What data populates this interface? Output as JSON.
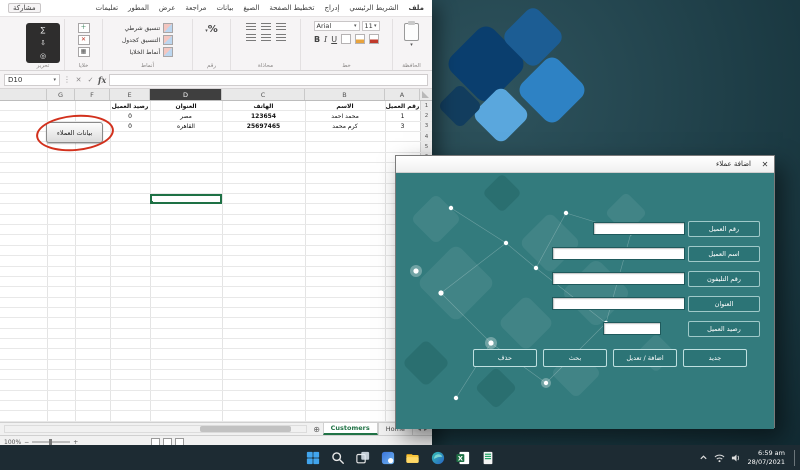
{
  "colors": {
    "form_teal": "#337b7d",
    "form_button_teal": "#2c7476",
    "excel_green": "#217346",
    "selection_green": "#1e7145",
    "annotation_red": "#d2301c",
    "taskbar_bg": "#1d2b33",
    "desktop_teal": "#1c3b44",
    "bloom_blue": "#2e82c4"
  },
  "excel": {
    "ribbon_tabs": [
      "ملف",
      "الشريط الرئيسي",
      "إدراج",
      "تخطيط الصفحة",
      "الصيغ",
      "بيانات",
      "مراجعة",
      "عرض",
      "المطور",
      "تعليمات",
      "مشاركة"
    ],
    "ribbon": {
      "font_name": "Arial",
      "font_size": "11",
      "bold": "B",
      "italic": "I",
      "underline": "U",
      "percent": "%",
      "sum": "∑",
      "styles_items": [
        "تنسيق شرطي",
        "التنسيق كجدول",
        "أنماط الخلايا"
      ],
      "group_labels": [
        "الحافظة",
        "خط",
        "محاذاة",
        "رقم",
        "أنماط",
        "خلايا",
        "تحرير"
      ]
    },
    "name_box": "D10",
    "formula_value": "",
    "fx": "fx",
    "column_letters": [
      "",
      "G",
      "F",
      "E",
      "D",
      "C",
      "B",
      "A"
    ],
    "row_count": 31,
    "selected_row_header": "10",
    "selected_cell": "D10",
    "sheet": {
      "header_row": {
        "A": "رقم العميل",
        "B": "الاسم",
        "C": "الهاتف",
        "D": "العنوان",
        "E": "رصيد العميل"
      },
      "data_rows": [
        {
          "A": "1",
          "B": "محمد احمد",
          "C": "123654",
          "D": "مصر",
          "E": "0"
        },
        {
          "A": "3",
          "B": "كرم محمد",
          "C": "25697465",
          "D": "القاهره",
          "E": "0"
        }
      ]
    },
    "customers_button": "بيانات العملاء",
    "sheet_tabs": [
      "Customers",
      "Home"
    ],
    "active_sheet_tab": "Customers",
    "status": {
      "zoom": "100%"
    }
  },
  "form": {
    "title": "اضافة عملاء",
    "close_icon": "✕",
    "fields": [
      {
        "label": "رقم العميل",
        "value": ""
      },
      {
        "label": "اسم العميل",
        "value": ""
      },
      {
        "label": "رقم التليفون",
        "value": ""
      },
      {
        "label": "العنوان",
        "value": ""
      },
      {
        "label": "رصيد العميل",
        "value": ""
      }
    ],
    "buttons": [
      "حذف",
      "بحث",
      "اضافة / تعديل",
      "جديد"
    ]
  },
  "taskbar": {
    "time": "6:59 am",
    "date": "28/07/2021"
  }
}
